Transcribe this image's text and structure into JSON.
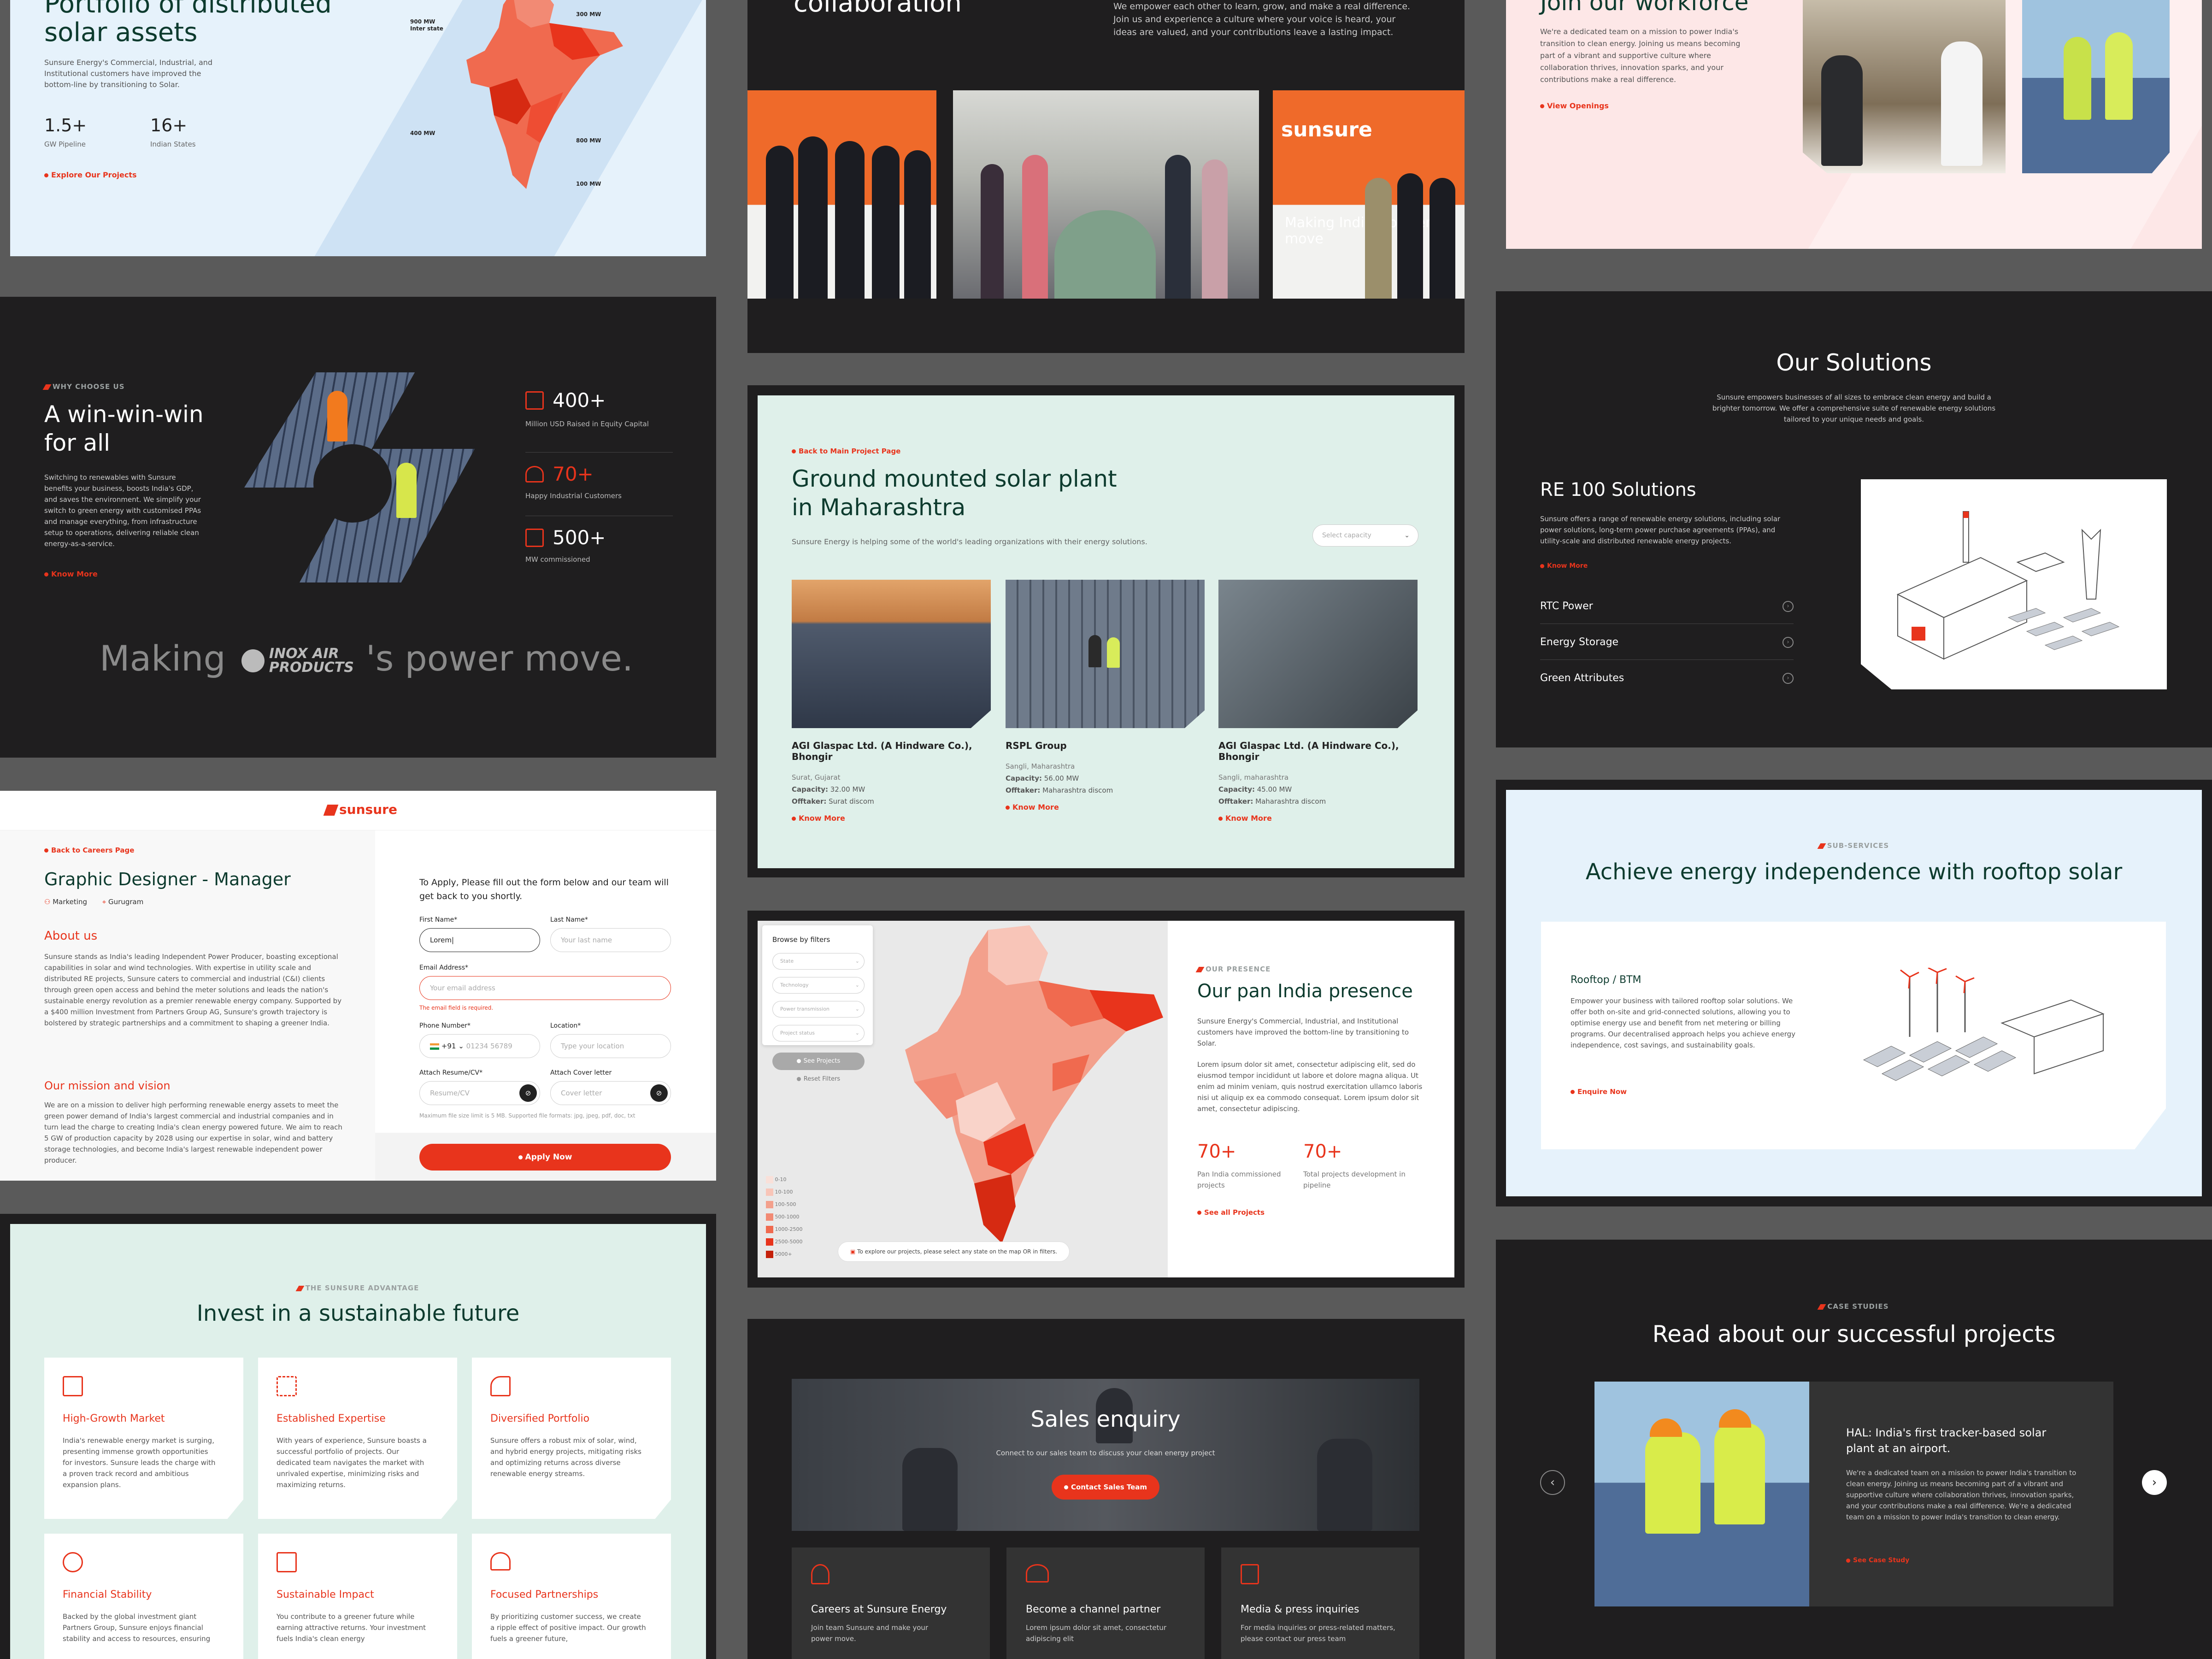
{
  "portfolio": {
    "title_line1": "Portfolio of distributed",
    "title_line2": "solar assets",
    "desc": "Sunsure Energy's Commercial, Industrial, and Institutional customers have improved the bottom-line by transitioning to Solar.",
    "stat1_value": "1.5+",
    "stat1_label": "GW Pipeline",
    "stat2_value": "16+",
    "stat2_label": "Indian States",
    "link": "Explore Our Projects",
    "map_labels": [
      "900 MW",
      "Inter state",
      "300 MW",
      "400 MW",
      "800 MW",
      "100 MW"
    ]
  },
  "collab": {
    "title": "collaboration",
    "desc": "We empower each other to learn, grow, and make a real difference. Join us and experience a culture where your voice is heard, your ideas are valued, and your contributions leave a lasting impact.",
    "banner_text": "Making India's power move",
    "logo": "sunsure"
  },
  "workforce": {
    "title": "Join our workforce",
    "desc": "We're a dedicated team on a mission to power India's transition to clean energy. Joining us means becoming part of a vibrant and supportive culture where collaboration thrives, innovation sparks, and your contributions make a real difference.",
    "link": "View Openings"
  },
  "winwin": {
    "eyebrow": "WHY CHOOSE US",
    "title_line1": "A win-win-win",
    "title_line2": "for all",
    "desc": "Switching to renewables with Sunsure benefits your business, boosts India's GDP, and saves the environment. We simplify your switch to green energy with customised PPAs and manage everything, from infrastructure setup to operations, delivering reliable clean energy-as-a-service.",
    "link": "Know More",
    "stats": [
      {
        "value": "400+",
        "label": "Million USD Raised in Equity Capital"
      },
      {
        "value": "70+",
        "label": "Happy Industrial Customers"
      },
      {
        "value": "500+",
        "label": "MW commissioned"
      }
    ],
    "making_prefix": "Making",
    "partner": "INOX AIR PRODUCTS",
    "making_suffix": "'s power move."
  },
  "ground": {
    "back": "Back to Main Project Page",
    "title_line1": "Ground mounted solar plant",
    "title_line2": "in Maharashtra",
    "desc": "Sunsure Energy is helping some of the world's leading organizations with their energy solutions.",
    "select": "Select capacity",
    "projects": [
      {
        "name": "AGI Glaspac Ltd. (A Hindware Co.), Bhongir",
        "loc": "Surat, Gujarat",
        "cap_label": "Capacity:",
        "cap": "32.00 MW",
        "off_label": "Offtaker:",
        "off": "Surat discom",
        "link": "Know More"
      },
      {
        "name": "RSPL Group",
        "loc": "Sangli, Maharashtra",
        "cap_label": "Capacity:",
        "cap": "56.00 MW",
        "off_label": "Offtaker:",
        "off": "Maharashtra discom",
        "link": "Know More"
      },
      {
        "name": "AGI Glaspac Ltd. (A Hindware Co.), Bhongir",
        "loc": "Sangli, maharashtra",
        "cap_label": "Capacity:",
        "cap": "45.00 MW",
        "off_label": "Offtaker:",
        "off": "Maharashtra discom",
        "link": "Know More"
      }
    ]
  },
  "solutions": {
    "title": "Our Solutions",
    "desc": "Sunsure empowers businesses of all sizes to embrace clean energy and build a brighter tomorrow. We offer a comprehensive suite of renewable energy solutions tailored to your unique needs and goals.",
    "re100_title": "RE 100 Solutions",
    "re100_desc": "Sunsure offers a range of renewable energy solutions, including solar power solutions, long-term power purchase agreements (PPAs), and utility-scale and distributed renewable energy projects.",
    "re100_link": "Know More",
    "items": [
      "RTC Power",
      "Energy Storage",
      "Green Attributes"
    ]
  },
  "career": {
    "logo": "sunsure",
    "back": "Back to Careers Page",
    "job_title": "Graphic Designer - Manager",
    "dept": "Marketing",
    "city": "Gurugram",
    "about_title": "About us",
    "about_text": "Sunsure stands as India's leading Independent Power Producer, boasting exceptional capabilities in solar and wind technologies. With expertise in utility scale and distributed RE projects, Sunsure caters to commercial and industrial (C&I) clients through green open access and behind the meter solutions and leads the nation's sustainable energy revolution as a premier renewable energy company. Supported by a $400 million Investment from Partners Group AG, Sunsure's growth trajectory is bolstered by strategic partnerships and a commitment to shaping a greener India.",
    "mission_title": "Our mission and vision",
    "mission_text": "We are on a mission to deliver high performing renewable energy assets to meet the green power demand of India's largest commercial and industrial companies and in turn lead the charge to creating India's clean energy powered future. We aim to reach 5 GW of production capacity by 2028 using our expertise in solar, wind and battery storage technologies, and become India's largest renewable independent power producer.",
    "form_intro": "To Apply, Please fill out the form below and our team will get back to you shortly.",
    "first_label": "First Name*",
    "first_value": "Lorem|",
    "last_label": "Last Name*",
    "last_ph": "Your last name",
    "email_label": "Email Address*",
    "email_ph": "Your email address",
    "email_error": "The email field is required.",
    "phone_label": "Phone Number*",
    "phone_code": "+91",
    "phone_ph": "01234 56789",
    "loc_label": "Location*",
    "loc_ph": "Type your location",
    "resume_label": "Attach Resume/CV*",
    "resume_ph": "Resume/CV",
    "cover_label": "Attach Cover letter",
    "cover_ph": "Cover letter",
    "file_note": "Maximum file size limit is 5 MB. Supported file formats: jpg, jpeg, pdf, doc, txt",
    "apply": "Apply Now"
  },
  "presence": {
    "filters_title": "Browse by filters",
    "filters": [
      "State",
      "Technology",
      "Power transmission",
      "Project status"
    ],
    "see_projects": "See Projects",
    "reset": "Reset Filters",
    "legend": [
      "0-10",
      "10-100",
      "100-500",
      "500-1000",
      "1000-2500",
      "2500-5000",
      "5000+"
    ],
    "hint": "To explore our projects, please select any state on the map OR in filters.",
    "eyebrow": "OUR PRESENCE",
    "title": "Our pan India presence",
    "desc1": "Sunsure Energy's Commercial, Industrial, and Institutional customers have improved the bottom-line by transitioning to Solar.",
    "desc2": "Lorem ipsum dolor sit amet, consectetur adipiscing elit, sed do eiusmod tempor incididunt ut labore et dolore magna aliqua. Ut enim ad minim veniam, quis nostrud exercitation ullamco laboris nisi ut aliquip ex ea commodo consequat. Lorem ipsum dolor sit amet, consectetur adipiscing.",
    "stat1_value": "70+",
    "stat1_label": "Pan India commissioned projects",
    "stat2_value": "70+",
    "stat2_label": "Total projects development in pipeline",
    "link": "See all Projects"
  },
  "rooftop": {
    "eyebrow": "SUB-SERVICES",
    "title": "Achieve energy independence with rooftop solar",
    "card_title": "Rooftop / BTM",
    "card_desc": "Empower your business with tailored rooftop solar solutions. We offer both on-site and grid-connected solutions, allowing you to optimise energy use and benefit from net metering or billing programs. Our decentralised approach helps you achieve energy independence, cost savings, and sustainability goals.",
    "link": "Enquire Now"
  },
  "invest": {
    "eyebrow": "THE SUNSURE ADVANTAGE",
    "title": "Invest in a sustainable future",
    "cards": [
      {
        "title": "High-Growth Market",
        "text": "India's renewable energy market is surging, presenting immense growth opportunities for investors. Sunsure leads the charge with a proven track record and ambitious expansion plans."
      },
      {
        "title": "Established Expertise",
        "text": "With years of experience, Sunsure boasts a successful portfolio of projects. Our dedicated team navigates the market with unrivaled expertise, minimizing risks and maximizing returns."
      },
      {
        "title": "Diversified Portfolio",
        "text": "Sunsure offers a robust mix of solar, wind, and hybrid energy projects, mitigating risks and optimizing returns across diverse renewable energy streams."
      },
      {
        "title": "Financial Stability",
        "text": "Backed by the global investment giant Partners Group, Sunsure enjoys financial stability and access to resources, ensuring"
      },
      {
        "title": "Sustainable Impact",
        "text": "You contribute to a greener future while earning attractive returns. Your investment fuels India's clean energy"
      },
      {
        "title": "Focused Partnerships",
        "text": "By prioritizing customer success, we create a ripple effect of positive impact. Our growth fuels a greener future,"
      }
    ]
  },
  "sales": {
    "title": "Sales enquiry",
    "desc": "Connect to our sales team to discuss your clean energy project",
    "button": "Contact Sales Team",
    "cards": [
      {
        "title": "Careers at Sunsure Energy",
        "text": "Join team Sunsure and make your power move."
      },
      {
        "title": "Become a channel partner",
        "text": "Lorem ipsum dolor sit amet, consectetur adipiscing elit"
      },
      {
        "title": "Media & press inquiries",
        "text": "For media inquiries or press-related matters, please contact our press team"
      }
    ]
  },
  "cases": {
    "eyebrow": "CASE STUDIES",
    "title": "Read about our successful projects",
    "card_title": "HAL: India's first tracker-based solar plant at an airport.",
    "card_desc": "We're a dedicated team on a mission to power India's transition to clean energy. Joining us means becoming part of a vibrant and supportive culture where collaboration thrives, innovation sparks, and your contributions make a real difference. We're a dedicated team on a mission to power India's transition to clean energy.",
    "link": "See Case Study"
  },
  "colors": {
    "accent": "#e8341c",
    "dark": "#1f1e1f",
    "heading_green": "#0d3b2e"
  }
}
